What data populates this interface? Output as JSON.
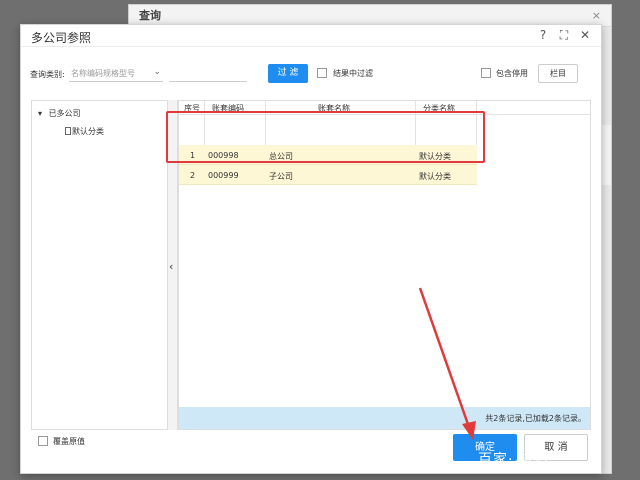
{
  "background_window": {
    "title": "查询",
    "close": "×"
  },
  "dialog": {
    "title": "多公司参照",
    "tools": {
      "help": "?",
      "maximize": "⛶",
      "close": "✕"
    }
  },
  "toolbar": {
    "category_label": "查询类别:",
    "category_placeholder": "名称编码规格型号",
    "caret": "⌄",
    "filter_button": "过 滤",
    "result_filter_label": "结果中过滤",
    "include_disabled_label": "包含停用",
    "columns_button": "栏目"
  },
  "tree": {
    "root": "已多公司",
    "root_arrow": "▾",
    "child": "默认分类"
  },
  "collapse_icon": "‹",
  "grid": {
    "headers": [
      "序号",
      "账套编码",
      "账套名称",
      "分类名称"
    ],
    "rows": [
      {
        "index": "1",
        "code": "000998",
        "name": "总公司",
        "category": "默认分类"
      },
      {
        "index": "2",
        "code": "000999",
        "name": "子公司",
        "category": "默认分类"
      }
    ],
    "footer": "共2条记录,已加载2条记录。"
  },
  "footer": {
    "overwrite_label": "覆盖原值",
    "ok_button": "确定",
    "cancel_button": "取 消"
  },
  "watermark": "百家·   技巧",
  "colors": {
    "primary": "#1f8cf0",
    "highlight": "#e03a3a",
    "row_selected": "#fdf7d6"
  }
}
